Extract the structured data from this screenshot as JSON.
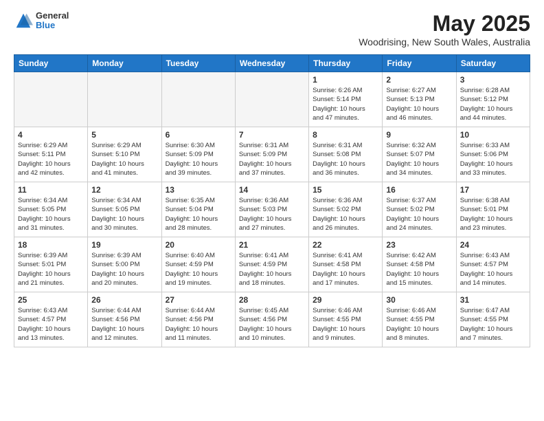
{
  "logo": {
    "general": "General",
    "blue": "Blue"
  },
  "header": {
    "month": "May 2025",
    "location": "Woodrising, New South Wales, Australia"
  },
  "weekdays": [
    "Sunday",
    "Monday",
    "Tuesday",
    "Wednesday",
    "Thursday",
    "Friday",
    "Saturday"
  ],
  "weeks": [
    [
      {
        "day": "",
        "info": ""
      },
      {
        "day": "",
        "info": ""
      },
      {
        "day": "",
        "info": ""
      },
      {
        "day": "",
        "info": ""
      },
      {
        "day": "1",
        "info": "Sunrise: 6:26 AM\nSunset: 5:14 PM\nDaylight: 10 hours\nand 47 minutes."
      },
      {
        "day": "2",
        "info": "Sunrise: 6:27 AM\nSunset: 5:13 PM\nDaylight: 10 hours\nand 46 minutes."
      },
      {
        "day": "3",
        "info": "Sunrise: 6:28 AM\nSunset: 5:12 PM\nDaylight: 10 hours\nand 44 minutes."
      }
    ],
    [
      {
        "day": "4",
        "info": "Sunrise: 6:29 AM\nSunset: 5:11 PM\nDaylight: 10 hours\nand 42 minutes."
      },
      {
        "day": "5",
        "info": "Sunrise: 6:29 AM\nSunset: 5:10 PM\nDaylight: 10 hours\nand 41 minutes."
      },
      {
        "day": "6",
        "info": "Sunrise: 6:30 AM\nSunset: 5:09 PM\nDaylight: 10 hours\nand 39 minutes."
      },
      {
        "day": "7",
        "info": "Sunrise: 6:31 AM\nSunset: 5:09 PM\nDaylight: 10 hours\nand 37 minutes."
      },
      {
        "day": "8",
        "info": "Sunrise: 6:31 AM\nSunset: 5:08 PM\nDaylight: 10 hours\nand 36 minutes."
      },
      {
        "day": "9",
        "info": "Sunrise: 6:32 AM\nSunset: 5:07 PM\nDaylight: 10 hours\nand 34 minutes."
      },
      {
        "day": "10",
        "info": "Sunrise: 6:33 AM\nSunset: 5:06 PM\nDaylight: 10 hours\nand 33 minutes."
      }
    ],
    [
      {
        "day": "11",
        "info": "Sunrise: 6:34 AM\nSunset: 5:05 PM\nDaylight: 10 hours\nand 31 minutes."
      },
      {
        "day": "12",
        "info": "Sunrise: 6:34 AM\nSunset: 5:05 PM\nDaylight: 10 hours\nand 30 minutes."
      },
      {
        "day": "13",
        "info": "Sunrise: 6:35 AM\nSunset: 5:04 PM\nDaylight: 10 hours\nand 28 minutes."
      },
      {
        "day": "14",
        "info": "Sunrise: 6:36 AM\nSunset: 5:03 PM\nDaylight: 10 hours\nand 27 minutes."
      },
      {
        "day": "15",
        "info": "Sunrise: 6:36 AM\nSunset: 5:02 PM\nDaylight: 10 hours\nand 26 minutes."
      },
      {
        "day": "16",
        "info": "Sunrise: 6:37 AM\nSunset: 5:02 PM\nDaylight: 10 hours\nand 24 minutes."
      },
      {
        "day": "17",
        "info": "Sunrise: 6:38 AM\nSunset: 5:01 PM\nDaylight: 10 hours\nand 23 minutes."
      }
    ],
    [
      {
        "day": "18",
        "info": "Sunrise: 6:39 AM\nSunset: 5:01 PM\nDaylight: 10 hours\nand 21 minutes."
      },
      {
        "day": "19",
        "info": "Sunrise: 6:39 AM\nSunset: 5:00 PM\nDaylight: 10 hours\nand 20 minutes."
      },
      {
        "day": "20",
        "info": "Sunrise: 6:40 AM\nSunset: 4:59 PM\nDaylight: 10 hours\nand 19 minutes."
      },
      {
        "day": "21",
        "info": "Sunrise: 6:41 AM\nSunset: 4:59 PM\nDaylight: 10 hours\nand 18 minutes."
      },
      {
        "day": "22",
        "info": "Sunrise: 6:41 AM\nSunset: 4:58 PM\nDaylight: 10 hours\nand 17 minutes."
      },
      {
        "day": "23",
        "info": "Sunrise: 6:42 AM\nSunset: 4:58 PM\nDaylight: 10 hours\nand 15 minutes."
      },
      {
        "day": "24",
        "info": "Sunrise: 6:43 AM\nSunset: 4:57 PM\nDaylight: 10 hours\nand 14 minutes."
      }
    ],
    [
      {
        "day": "25",
        "info": "Sunrise: 6:43 AM\nSunset: 4:57 PM\nDaylight: 10 hours\nand 13 minutes."
      },
      {
        "day": "26",
        "info": "Sunrise: 6:44 AM\nSunset: 4:56 PM\nDaylight: 10 hours\nand 12 minutes."
      },
      {
        "day": "27",
        "info": "Sunrise: 6:44 AM\nSunset: 4:56 PM\nDaylight: 10 hours\nand 11 minutes."
      },
      {
        "day": "28",
        "info": "Sunrise: 6:45 AM\nSunset: 4:56 PM\nDaylight: 10 hours\nand 10 minutes."
      },
      {
        "day": "29",
        "info": "Sunrise: 6:46 AM\nSunset: 4:55 PM\nDaylight: 10 hours\nand 9 minutes."
      },
      {
        "day": "30",
        "info": "Sunrise: 6:46 AM\nSunset: 4:55 PM\nDaylight: 10 hours\nand 8 minutes."
      },
      {
        "day": "31",
        "info": "Sunrise: 6:47 AM\nSunset: 4:55 PM\nDaylight: 10 hours\nand 7 minutes."
      }
    ]
  ]
}
